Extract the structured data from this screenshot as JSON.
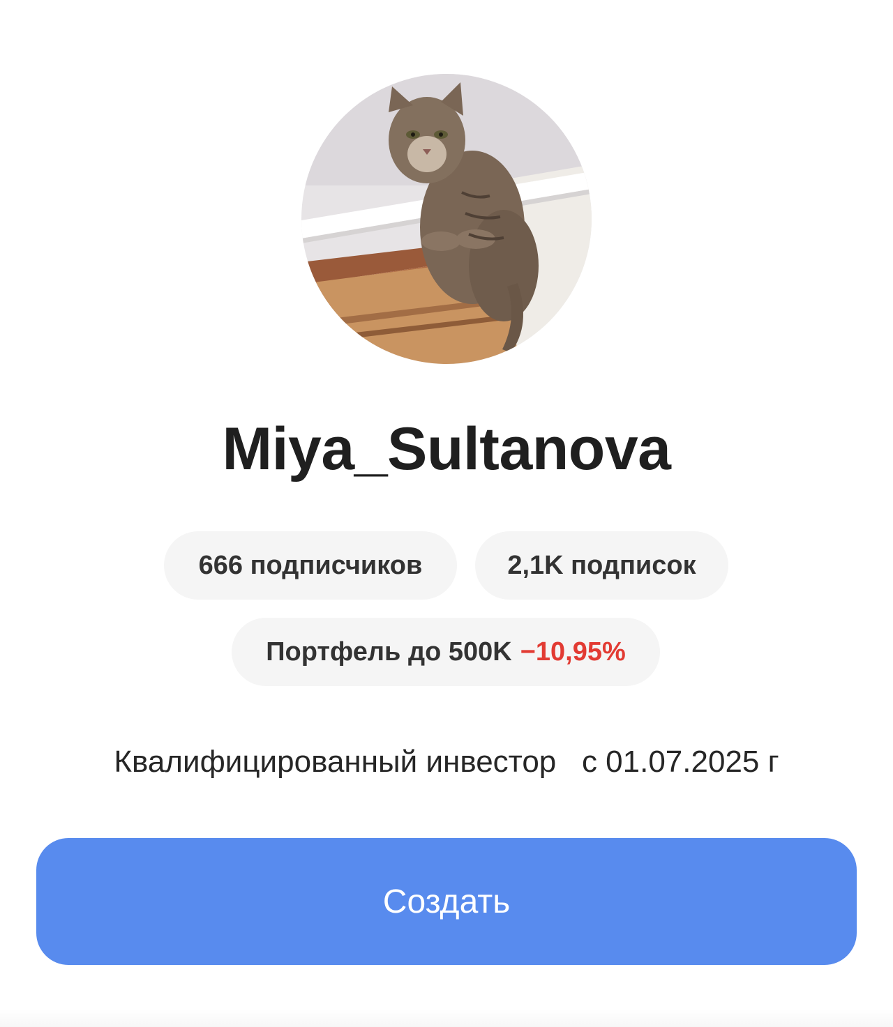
{
  "profile": {
    "username": "Miya_Sultanova",
    "avatar_description": "cat-photo",
    "followers_label": "666 подписчиков",
    "following_label": "2,1K подписок",
    "portfolio": {
      "label": "Портфель до 500K",
      "change": "−10,95%",
      "change_color": "#e23b33"
    },
    "qualified_status": "Квалифицированный инвестор   с 01.07.2025 г"
  },
  "actions": {
    "create_label": "Создать",
    "create_color": "#588bee"
  }
}
